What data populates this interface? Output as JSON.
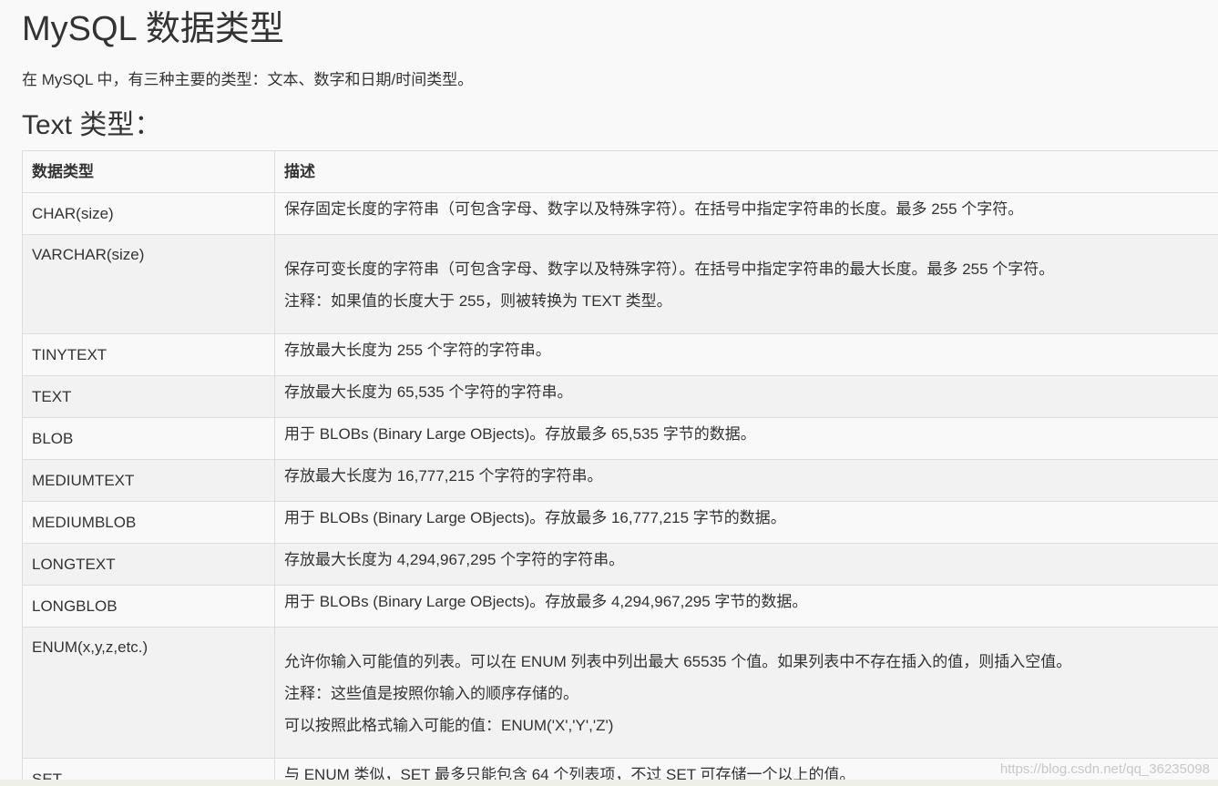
{
  "title": "MySQL 数据类型",
  "intro": "在 MySQL 中，有三种主要的类型：文本、数字和日期/时间类型。",
  "section_title": "Text 类型：",
  "table": {
    "headers": [
      "数据类型",
      "描述"
    ],
    "rows": [
      {
        "type": "CHAR(size)",
        "desc": [
          "保存固定长度的字符串（可包含字母、数字以及特殊字符）。在括号中指定字符串的长度。最多 255 个字符。"
        ]
      },
      {
        "type": "VARCHAR(size)",
        "desc": [
          "保存可变长度的字符串（可包含字母、数字以及特殊字符）。在括号中指定字符串的最大长度。最多 255 个字符。",
          "注释：如果值的长度大于 255，则被转换为 TEXT 类型。"
        ]
      },
      {
        "type": "TINYTEXT",
        "desc": [
          "存放最大长度为 255 个字符的字符串。"
        ]
      },
      {
        "type": "TEXT",
        "desc": [
          "存放最大长度为 65,535 个字符的字符串。"
        ]
      },
      {
        "type": "BLOB",
        "desc": [
          "用于 BLOBs (Binary Large OBjects)。存放最多 65,535 字节的数据。"
        ]
      },
      {
        "type": "MEDIUMTEXT",
        "desc": [
          "存放最大长度为 16,777,215 个字符的字符串。"
        ]
      },
      {
        "type": "MEDIUMBLOB",
        "desc": [
          "用于 BLOBs (Binary Large OBjects)。存放最多 16,777,215 字节的数据。"
        ]
      },
      {
        "type": "LONGTEXT",
        "desc": [
          "存放最大长度为 4,294,967,295 个字符的字符串。"
        ]
      },
      {
        "type": "LONGBLOB",
        "desc": [
          "用于 BLOBs (Binary Large OBjects)。存放最多 4,294,967,295 字节的数据。"
        ]
      },
      {
        "type": "ENUM(x,y,z,etc.)",
        "desc": [
          "允许你输入可能值的列表。可以在 ENUM 列表中列出最大 65535 个值。如果列表中不存在插入的值，则插入空值。",
          "注释：这些值是按照你输入的顺序存储的。",
          "可以按照此格式输入可能的值：ENUM('X','Y','Z')"
        ]
      },
      {
        "type": "SET",
        "desc": [
          "与 ENUM 类似，SET 最多只能包含 64 个列表项，不过 SET 可存储一个以上的值。"
        ]
      }
    ]
  },
  "watermark": "https://blog.csdn.net/qq_36235098"
}
